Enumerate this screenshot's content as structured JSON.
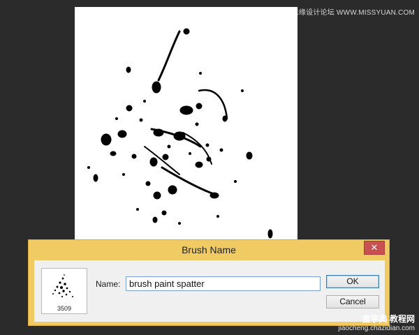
{
  "watermark": {
    "top": "思缘设计论坛 WWW.MISSYUAN.COM",
    "bottom_logo": "查字典 教程网",
    "bottom_url": "jiaocheng.chazidian.com"
  },
  "dialog": {
    "title": "Brush Name",
    "close_symbol": "✕",
    "brush_size": "3509",
    "name_label": "Name:",
    "name_value": "brush paint spatter",
    "ok_label": "OK",
    "cancel_label": "Cancel"
  },
  "colors": {
    "workspace": "#2b2b2b",
    "dialog_frame": "#f0cb63",
    "close_button": "#c75050",
    "paint": "#000000"
  }
}
